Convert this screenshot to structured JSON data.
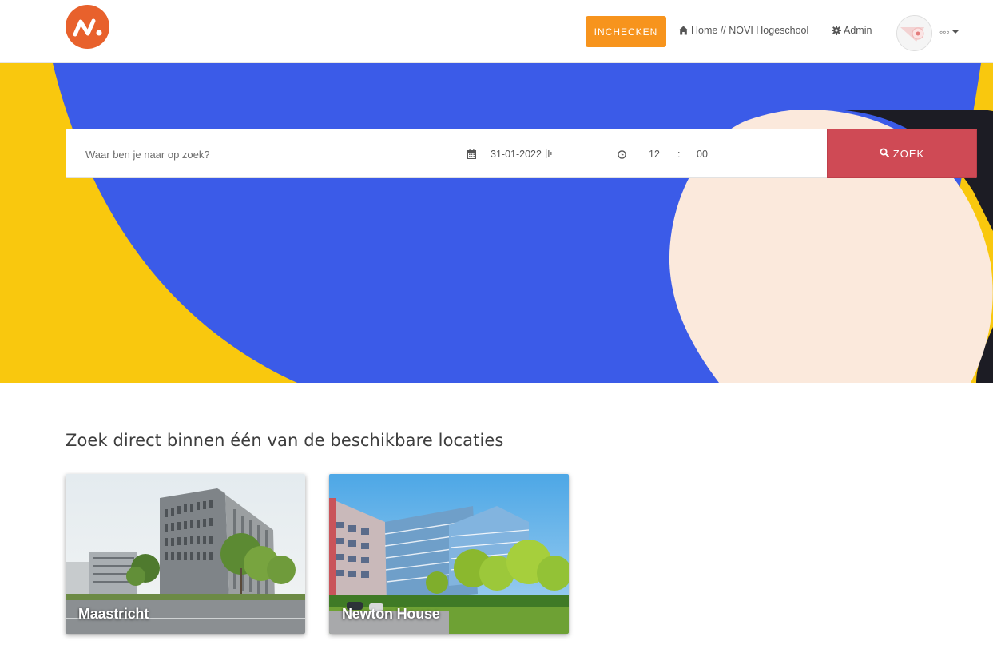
{
  "header": {
    "checkin_label": "INCHECKEN",
    "home_label": "Home // NOVI Hogeschool",
    "admin_label": "Admin",
    "user_label": "◦◦◦"
  },
  "search": {
    "placeholder": "Waar ben je naar op zoek?",
    "date": "31-01-2022",
    "hour": "12",
    "time_separator": ":",
    "minute": "00",
    "button_label": "ZOEK"
  },
  "locations": {
    "title": "Zoek direct binnen één van de beschikbare locaties",
    "items": [
      {
        "label": "Maastricht"
      },
      {
        "label": "Newton House"
      }
    ]
  },
  "colors": {
    "brand_orange": "#e8612c",
    "checkin_orange": "#f7941d",
    "hero_blue": "#3b5be8",
    "hero_yellow": "#f9c80e",
    "hero_peach": "#fbe9dc",
    "search_red": "#cf4a55"
  },
  "icons": {
    "home": "home-icon",
    "admin": "gear-icon",
    "date": "calendar-icon",
    "time": "clock-icon",
    "search": "search-icon"
  }
}
